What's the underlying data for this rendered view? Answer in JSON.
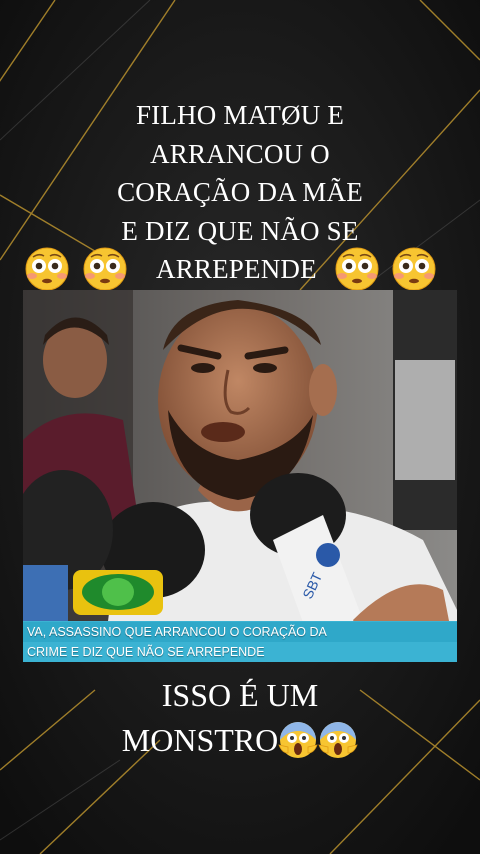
{
  "headline": {
    "lines": [
      "FILHO MATØU E",
      "ARRANCOU O",
      "CORAÇÃO DA MÃE",
      "E DIZ QUE NÃO SE",
      "ARREPENDE"
    ],
    "emoji": "flushed-face-icon"
  },
  "video": {
    "ticker_line1": "VA, ASSASSINO QUE ARRANCOU O CORAÇÃO DA",
    "ticker_line2": "CRIME E DIZ QUE NÃO SE ARREPENDE",
    "ticker_color": "#3bb3d3"
  },
  "caption": {
    "line1": "ISSO É UM",
    "line2": "MONSTRO",
    "emoji": "screaming-face-icon"
  },
  "colors": {
    "background": "#151515",
    "accent_lines": "#b8912e",
    "text": "#ffffff"
  }
}
